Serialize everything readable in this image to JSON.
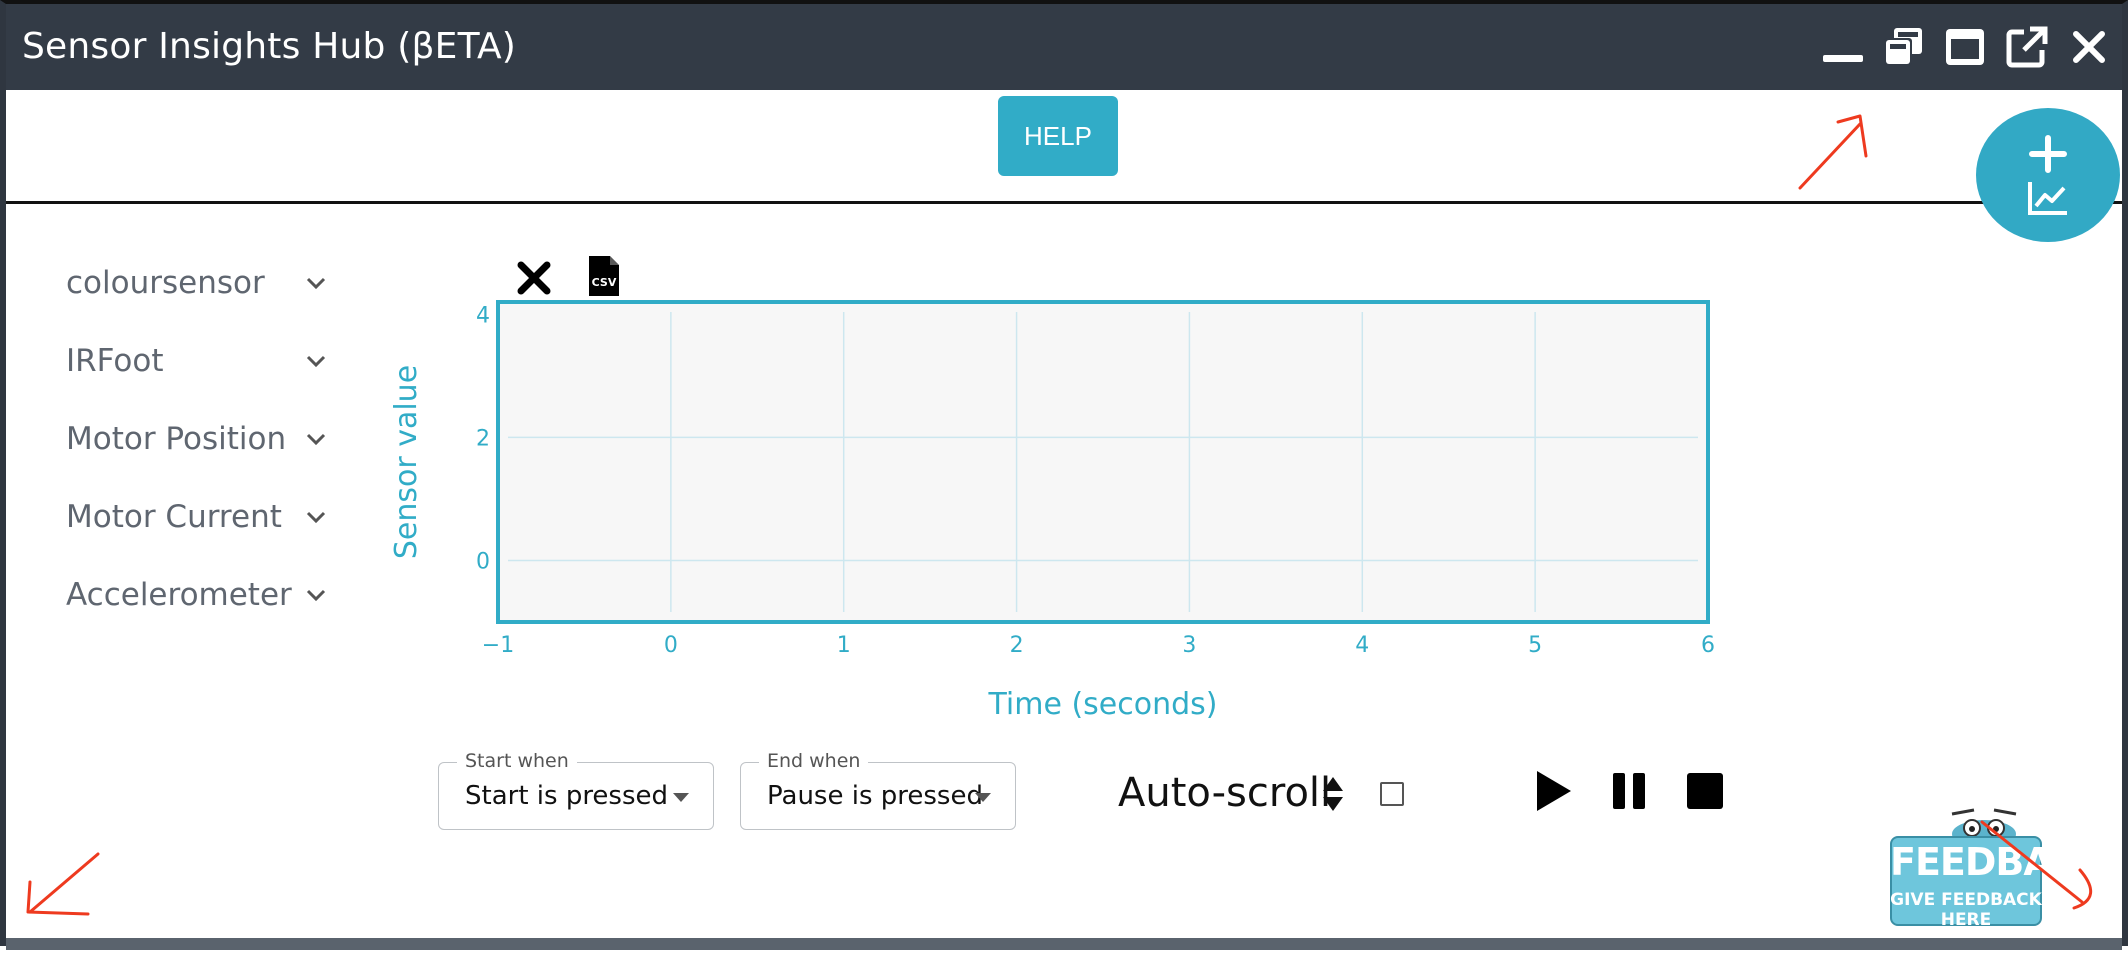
{
  "window": {
    "title": "Sensor Insights Hub (βETA)",
    "controls": [
      "minimize-icon",
      "restore-icon",
      "maximize-icon",
      "pop-out-icon",
      "close-icon"
    ]
  },
  "toolbar": {
    "help_label": "HELP"
  },
  "fab": {
    "icons": [
      "plus-icon",
      "chart-icon"
    ]
  },
  "sidebar": {
    "items": [
      {
        "label": "coloursensor"
      },
      {
        "label": "IRFoot"
      },
      {
        "label": "Motor Position"
      },
      {
        "label": "Motor Current"
      },
      {
        "label": "Accelerometer"
      }
    ]
  },
  "chart_tools": {
    "icons": [
      "close-icon",
      "csv-file-icon"
    ],
    "csv_text": "CSV"
  },
  "chart_data": {
    "type": "line",
    "title": "",
    "xlabel": "Time (seconds)",
    "ylabel": "Sensor value",
    "xlim": [
      -1,
      6
    ],
    "ylim": [
      -1,
      4.2
    ],
    "x_ticks": [
      -1,
      0,
      1,
      2,
      3,
      4,
      5,
      6
    ],
    "y_ticks": [
      0,
      2,
      4
    ],
    "x_tick_labels": [
      "−1",
      "0",
      "1",
      "2",
      "3",
      "4",
      "5",
      "6"
    ],
    "y_tick_labels": [
      "0",
      "2",
      "4"
    ],
    "grid": true,
    "series": [],
    "colors": {
      "axis": "#31acc7",
      "plot_bg": "#f7f7f7",
      "grid": "#cde7ef"
    }
  },
  "controls": {
    "start_when": {
      "legend": "Start when",
      "value": "Start is pressed"
    },
    "end_when": {
      "legend": "End when",
      "value": "Pause is pressed"
    },
    "autoscroll_label": "Auto-scroll",
    "autoscroll_checked": false,
    "media_icons": [
      "play-icon",
      "pause-icon",
      "stop-icon"
    ]
  },
  "feedback": {
    "title": "FEEDBACK",
    "subtitle": "GIVE FEEDBACK HERE"
  },
  "colors": {
    "accent": "#31acc7",
    "titlebar": "#333b46",
    "annotation": "#ee3a1f"
  }
}
